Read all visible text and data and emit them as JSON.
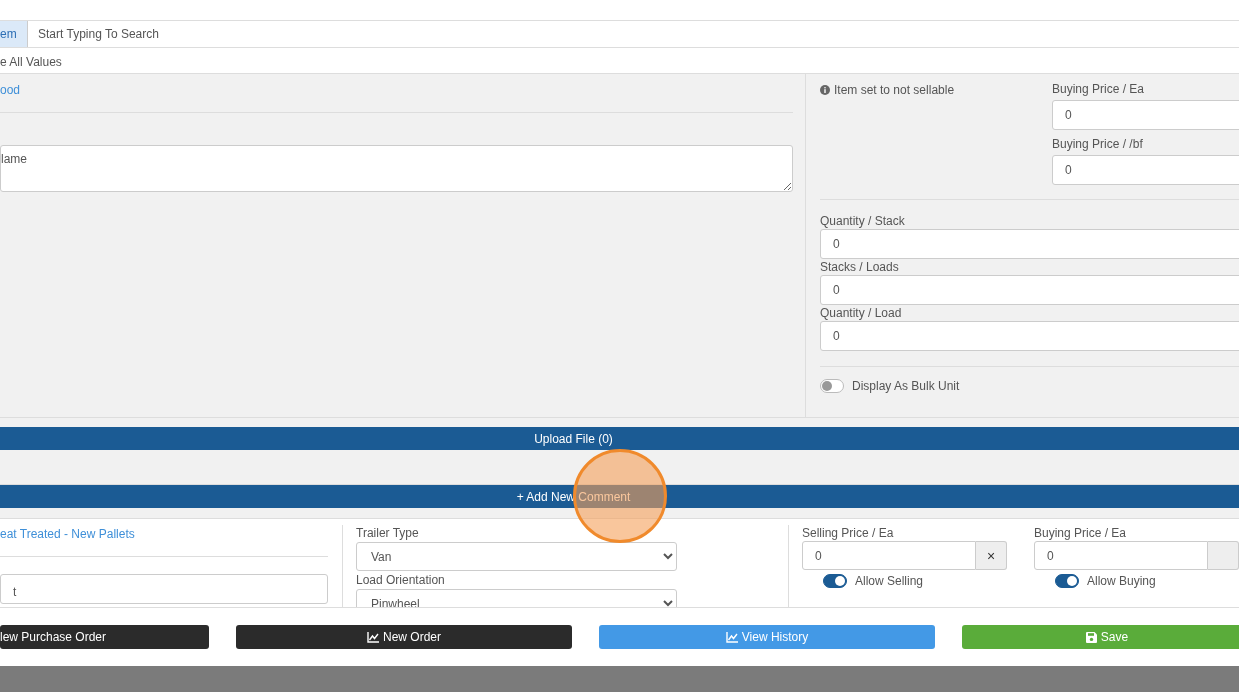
{
  "search": {
    "addon": "em",
    "placeholder": "Start Typing To Search"
  },
  "note": "e All Values",
  "item": {
    "link": "ood",
    "name_placeholder": "lame"
  },
  "sellable_notice": "Item set to not sellable",
  "buying_fields": [
    {
      "label": "Buying Price / Ea",
      "value": "0"
    },
    {
      "label": "Buying Price / /bf",
      "value": "0"
    }
  ],
  "quantity_fields": [
    {
      "label": "Quantity / Stack",
      "value": "0"
    },
    {
      "label": "Stacks / Loads",
      "value": "0"
    },
    {
      "label": "Quantity / Load",
      "value": "0"
    }
  ],
  "bulk_toggle": {
    "label": "Display As Bulk Unit",
    "on": false
  },
  "upload_bar": "Upload File (0)",
  "comment_bar": "+ Add New Comment",
  "order_line": {
    "link": "eat Treated - New Pallets",
    "field_value": "t",
    "trailer_type": {
      "label": "Trailer Type",
      "value": "Van"
    },
    "load_orientation": {
      "label": "Load Orientation",
      "value": "Pinwheel"
    },
    "selling": {
      "label": "Selling Price / Ea",
      "value": "0",
      "clear": "×",
      "toggle_label": "Allow Selling",
      "on": true
    },
    "buying": {
      "label": "Buying Price / Ea",
      "value": "0",
      "toggle_label": "Allow Buying",
      "on": true
    }
  },
  "buttons": [
    {
      "label": "lew Purchase Order",
      "kind": "dark"
    },
    {
      "label": "New Order",
      "kind": "dark"
    },
    {
      "label": "View History",
      "kind": "info"
    },
    {
      "label": "Save",
      "kind": "success"
    }
  ]
}
